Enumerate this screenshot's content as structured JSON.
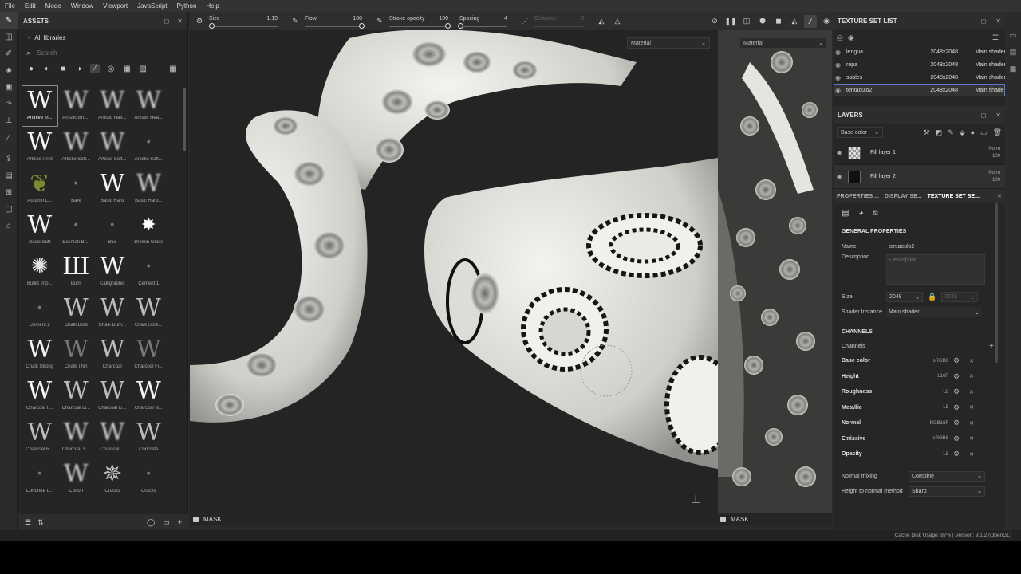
{
  "menu": [
    "File",
    "Edit",
    "Mode",
    "Window",
    "Viewport",
    "JavaScript",
    "Python",
    "Help"
  ],
  "toolbar": {
    "tools": [
      "brush-icon",
      "eraser-icon",
      "projection-icon",
      "geometry-icon",
      "picker-icon",
      "smudge-icon",
      "clone-icon",
      "color-picker-icon",
      "export-icon",
      "layers-icon",
      "bake-icon",
      "texture-icon",
      "render-icon"
    ]
  },
  "assets": {
    "title": "ASSETS",
    "libraries": "All libraries",
    "search_placeholder": "Search",
    "items": [
      {
        "label": "Archive In...",
        "glyph": "W",
        "style": "",
        "badge": false
      },
      {
        "label": "Artistic Bru...",
        "glyph": "W",
        "style": "soft",
        "badge": false
      },
      {
        "label": "Artistic Hair...",
        "glyph": "W",
        "style": "soft",
        "badge": false
      },
      {
        "label": "Artistic Hea...",
        "glyph": "W",
        "style": "soft",
        "badge": false
      },
      {
        "label": "Artistic Print",
        "glyph": "W",
        "style": "",
        "badge": false
      },
      {
        "label": "Artistic Soft...",
        "glyph": "W",
        "style": "soft",
        "badge": false
      },
      {
        "label": "Artistic Soft...",
        "glyph": "W",
        "style": "soft",
        "badge": false
      },
      {
        "label": "Artistic Soft...",
        "glyph": "·",
        "style": "dim",
        "badge": true
      },
      {
        "label": "Autumn L...",
        "glyph": "❦",
        "style": "leaf",
        "badge": true
      },
      {
        "label": "Bark",
        "glyph": "·",
        "style": "dim",
        "badge": false
      },
      {
        "label": "Basic Hard",
        "glyph": "W",
        "style": "",
        "badge": false
      },
      {
        "label": "Basic Hard...",
        "glyph": "W",
        "style": "soft",
        "badge": false
      },
      {
        "label": "Basic Soft",
        "glyph": "W",
        "style": "",
        "badge": false
      },
      {
        "label": "Basmati Br...",
        "glyph": "·",
        "style": "dim",
        "badge": true
      },
      {
        "label": "Blur",
        "glyph": "·",
        "style": "dim",
        "badge": false
      },
      {
        "label": "Broken Glass",
        "glyph": "✸",
        "style": "star",
        "badge": true
      },
      {
        "label": "Bullet Imp...",
        "glyph": "✺",
        "style": "ball",
        "badge": false
      },
      {
        "label": "Burn",
        "glyph": "Ш",
        "style": "",
        "badge": false
      },
      {
        "label": "Calligraphic",
        "glyph": "W",
        "style": "",
        "badge": false
      },
      {
        "label": "Cement 1",
        "glyph": "·",
        "style": "dim",
        "badge": true
      },
      {
        "label": "Cement 2",
        "glyph": "·",
        "style": "dim",
        "badge": true
      },
      {
        "label": "Chalk Bold",
        "glyph": "W",
        "style": "thin",
        "badge": false
      },
      {
        "label": "Chalk Bum...",
        "glyph": "W",
        "style": "thin",
        "badge": false
      },
      {
        "label": "Chalk Spre...",
        "glyph": "W",
        "style": "thin",
        "badge": false
      },
      {
        "label": "Chalk Strong",
        "glyph": "W",
        "style": "",
        "badge": false
      },
      {
        "label": "Chalk Thin",
        "glyph": "W",
        "style": "dim",
        "badge": false
      },
      {
        "label": "Charcoal",
        "glyph": "W",
        "style": "thin",
        "badge": false
      },
      {
        "label": "Charcoal Fi...",
        "glyph": "W",
        "style": "dim",
        "badge": false
      },
      {
        "label": "Charcoal F...",
        "glyph": "W",
        "style": "",
        "badge": false
      },
      {
        "label": "Charcoal Li...",
        "glyph": "W",
        "style": "thin",
        "badge": false
      },
      {
        "label": "Charcoal Li...",
        "glyph": "W",
        "style": "thin",
        "badge": false
      },
      {
        "label": "Charcoal N...",
        "glyph": "W",
        "style": "",
        "badge": false
      },
      {
        "label": "Charcoal R...",
        "glyph": "W",
        "style": "thin",
        "badge": false
      },
      {
        "label": "Charcoal S...",
        "glyph": "W",
        "style": "soft",
        "badge": false
      },
      {
        "label": "Charcoal ...",
        "glyph": "W",
        "style": "soft",
        "badge": false
      },
      {
        "label": "Concrete",
        "glyph": "W",
        "style": "thin",
        "badge": false
      },
      {
        "label": "Concrete L...",
        "glyph": "·",
        "style": "dim",
        "badge": true
      },
      {
        "label": "Cotton",
        "glyph": "W",
        "style": "soft",
        "badge": false
      },
      {
        "label": "Cracks",
        "glyph": "✵",
        "style": "thin",
        "badge": false
      },
      {
        "label": "Cracks",
        "glyph": "·",
        "style": "dim",
        "badge": true
      }
    ]
  },
  "brush": {
    "size_label": "Size",
    "size_value": "1.19",
    "size_level": 0.05,
    "flow_label": "Flow",
    "flow_value": "100",
    "flow_level": 1.0,
    "opacity_label": "Stroke opacity",
    "opacity_value": "100",
    "opacity_level": 1.0,
    "spacing_label": "Spacing",
    "spacing_value": "4",
    "spacing_level": 0.04,
    "distance_label": "Distance",
    "distance_value": "8"
  },
  "viewport": {
    "main_mode": "Material",
    "uv_mode": "Material",
    "mask_label": "MASK"
  },
  "texture_sets": {
    "title": "TEXTURE SET LIST",
    "rows": [
      {
        "name": "lengua",
        "size": "2048x2048",
        "shader": "Main shader",
        "selected": false
      },
      {
        "name": "ropa",
        "size": "2048x2048",
        "shader": "Main shader",
        "selected": false
      },
      {
        "name": "sables",
        "size": "2048x2048",
        "shader": "Main shader",
        "selected": false
      },
      {
        "name": "tentaculo2",
        "size": "2048x2048",
        "shader": "Main shader",
        "selected": true
      }
    ]
  },
  "layers": {
    "title": "LAYERS",
    "channel": "Base color",
    "rows": [
      {
        "name": "Fill layer 1",
        "blend": "Norm",
        "opacity": "100",
        "swatch": "checker"
      },
      {
        "name": "Fill layer 2",
        "blend": "Norm",
        "opacity": "100",
        "swatch": "dark"
      }
    ]
  },
  "props": {
    "tabs": [
      "PROPERTIES ...",
      "DISPLAY SE...",
      "TEXTURE SET SE..."
    ],
    "general_title": "GENERAL PROPERTIES",
    "name_label": "Name",
    "name_value": "tentaculo2",
    "description_label": "Description",
    "description_placeholder": "Description",
    "size_label": "Size",
    "size_value": "2048",
    "size_value2": "2048",
    "shader_label": "Shader Instance",
    "shader_value": "Main shader",
    "channels_title": "CHANNELS",
    "channels_label": "Channels",
    "channels": [
      {
        "name": "Base color",
        "format": "sRGB8",
        "ref": true
      },
      {
        "name": "Height",
        "format": "L16F",
        "ref": false
      },
      {
        "name": "Roughness",
        "format": "L8",
        "ref": false
      },
      {
        "name": "Metallic",
        "format": "L8",
        "ref": false
      },
      {
        "name": "Normal",
        "format": "RGB16F",
        "ref": false
      },
      {
        "name": "Emissive",
        "format": "sRGB8",
        "ref": true
      },
      {
        "name": "Opacity",
        "format": "L8",
        "ref": false
      }
    ],
    "normal_mixing_label": "Normal mixing",
    "normal_mixing_value": "Combine",
    "height_method_label": "Height to normal method",
    "height_method_value": "Sharp"
  },
  "status": "Cache Disk Usage:  87% | Version: 9.1.2 (OpenGL)"
}
